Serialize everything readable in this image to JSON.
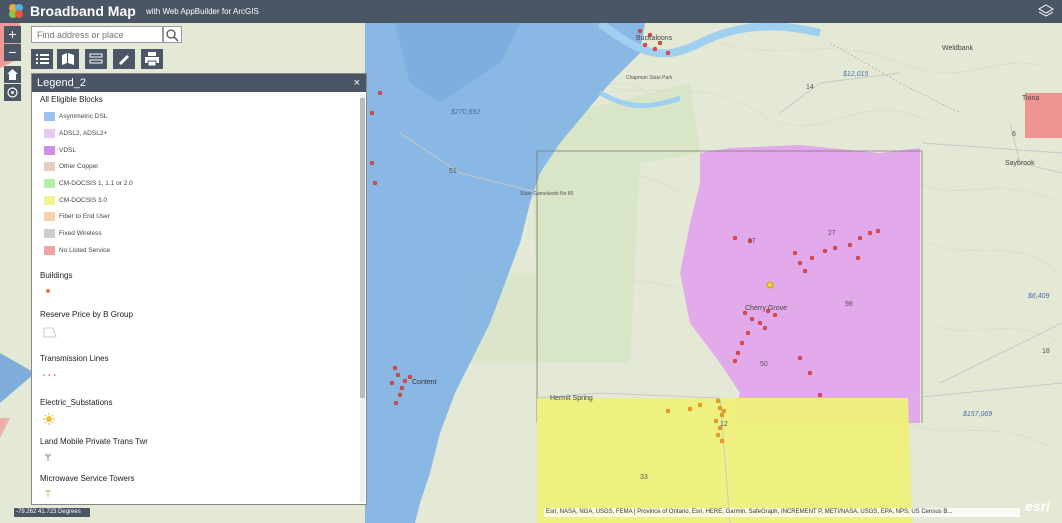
{
  "app": {
    "title": "Broadband Map",
    "subtitle": "with Web AppBuilder for ArcGIS"
  },
  "search": {
    "placeholder": "Find address or place"
  },
  "zoom": {
    "in": "+",
    "out": "−"
  },
  "legend": {
    "title": "Legend_2",
    "close": "×",
    "eligible_blocks_title": "All Eligible Blocks",
    "eligible_blocks": [
      {
        "label": "Asymmetric DSL",
        "color": "#9cc3ef"
      },
      {
        "label": "ADSL2, ADSL2+",
        "color": "#e8c7f2"
      },
      {
        "label": "VDSL",
        "color": "#cf8fe6"
      },
      {
        "label": "Other Copper",
        "color": "#e6cdc0"
      },
      {
        "label": "CM-DOCSIS 1, 1.1 or 2.0",
        "color": "#b5eea6"
      },
      {
        "label": "CM-DOCSIS 3.0",
        "color": "#f3f38f"
      },
      {
        "label": "Fiber to End User",
        "color": "#f8d3a8"
      },
      {
        "label": "Fixed Wireless",
        "color": "#cdcdcd"
      },
      {
        "label": "No Listed Service",
        "color": "#f3a3a7"
      }
    ],
    "sections": [
      {
        "title": "Buildings"
      },
      {
        "title": "Reserve Price by B Group"
      },
      {
        "title": "Transmission Lines"
      },
      {
        "title": "Electric_Substations"
      },
      {
        "title": "Land Mobile Private Trans Twr"
      },
      {
        "title": "Microwave Service Towers"
      }
    ]
  },
  "map_labels": {
    "weldbank": "Weldbank",
    "tiona": "Tiona",
    "saybrook": "Saybrook",
    "cherry_grove": "Cherry Grove",
    "hermit_spring": "Hermit Spring",
    "content": "Content",
    "buckaloons": "Buckaloons",
    "chapman": "Chapman State Park",
    "state_gamelands": "State Gamelands No 86",
    "price1": "$270,892",
    "price2": "$12,015",
    "price3": "$6,409",
    "price4": "$157,069",
    "rt6": "6",
    "rt14": "14",
    "n27a": "27",
    "n27b": "27",
    "n51": "51",
    "n98": "98",
    "n50": "50",
    "n33": "33",
    "n12": "12",
    "n18": "18"
  },
  "coords": "-79.262 41.723 Degrees",
  "attribution": "Esri, NASA, NGA, USGS, FEMA | Province of Ontario, Esri, HERE, Garmin, SafeGraph, INCREMENT P, METI/NASA, USGS, EPA, NPS, US Census B...",
  "esri_logo": "esri",
  "colors": {
    "header": "#4a5566",
    "dsl_blue": "#7fb2e6",
    "vdsl_pink": "#e3a7ec",
    "docsis_yellow": "#eef07a",
    "red_block": "#f08b8b",
    "building_dot": "#e04a4a"
  }
}
